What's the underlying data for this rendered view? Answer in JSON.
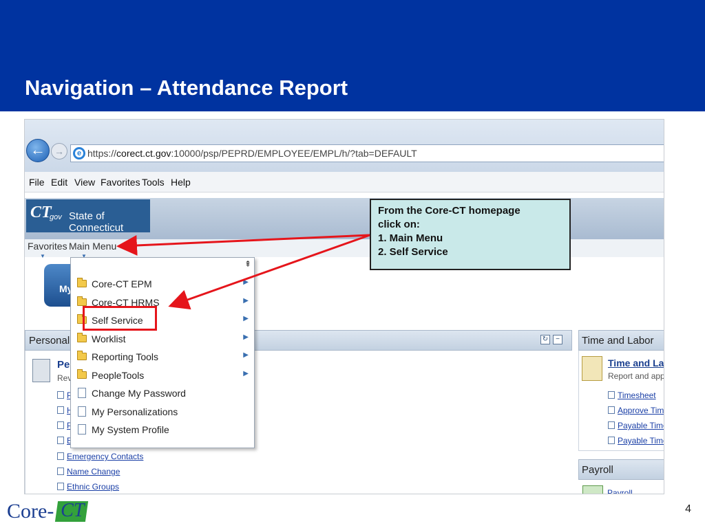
{
  "slide": {
    "title": "Navigation – Attendance Report",
    "page_number": "4",
    "logo_text_core": "Core-",
    "logo_text_ct": "CT"
  },
  "browser": {
    "url_prefix": "https://",
    "url_host": "corect.ct.gov",
    "url_path": ":10000/psp/PEPRD/EMPLOYEE/EMPL/h/?tab=DEFAULT",
    "menu": [
      "File",
      "Edit",
      "View",
      "Favorites",
      "Tools",
      "Help"
    ]
  },
  "portal": {
    "logo_ct": "CT",
    "logo_gov": "gov",
    "logo_name": "State of Connecticut",
    "nav": [
      "Favorites",
      "Main Menu"
    ],
    "my_tab": "My"
  },
  "dropdown": {
    "scroll_glyph": "⇞",
    "items": [
      {
        "label": "Core-CT EPM",
        "icon": "folder-icon",
        "submenu": true
      },
      {
        "label": "Core-CT HRMS",
        "icon": "folder-icon",
        "submenu": true
      },
      {
        "label": "Self Service",
        "icon": "folder-icon",
        "submenu": true
      },
      {
        "label": "Worklist",
        "icon": "folder-icon",
        "submenu": true
      },
      {
        "label": "Reporting Tools",
        "icon": "folder-icon",
        "submenu": true
      },
      {
        "label": "PeopleTools",
        "icon": "folder-icon",
        "submenu": true
      },
      {
        "label": "Change My Password",
        "icon": "page-icon",
        "submenu": false
      },
      {
        "label": "My Personalizations",
        "icon": "page-icon",
        "submenu": false
      },
      {
        "label": "My System Profile",
        "icon": "page-icon",
        "submenu": false
      }
    ]
  },
  "personal_pagelet": {
    "header": "Personal I",
    "title": "Per",
    "subtitle": "Rev",
    "hidden_links": [
      "P",
      "H",
      "P",
      "E"
    ],
    "links": [
      "Emergency Contacts",
      "Name Change",
      "Ethnic Groups"
    ]
  },
  "time_labor": {
    "header": "Time and Labor",
    "title": "Time and Labor",
    "subtitle": "Report and approv",
    "links": [
      "Timesheet",
      "Approve Time",
      "Payable Time S",
      "Payable Time D"
    ]
  },
  "payroll": {
    "header": "Payroll",
    "link": "Payroll"
  },
  "callout": {
    "line1": "From the Core-CT homepage",
    "line2": "click on:",
    "line3": "1.  Main Menu",
    "line4": "2.  Self Service"
  },
  "colors": {
    "header_blue": "#0033a0",
    "callout_bg": "#c9e9e9",
    "highlight_red": "#e5151b"
  }
}
